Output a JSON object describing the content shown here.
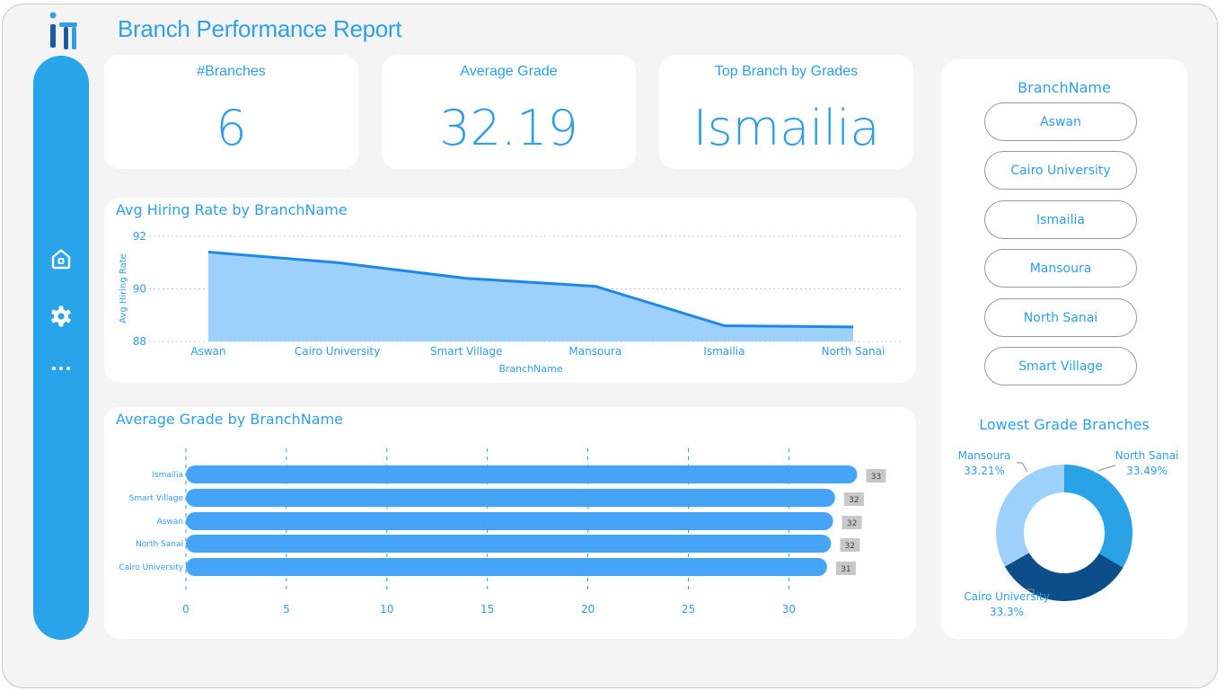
{
  "report": {
    "title": "Branch Performance Report"
  },
  "colors": {
    "accent": "#2fa0e8",
    "sidebar": "#29a3ea",
    "bar": "#45a4f5",
    "area_fill": "#9ed0fc",
    "area_line": "#1e88e5",
    "donut": [
      "#2aa3e6",
      "#0d4e8a",
      "#9ed0fc"
    ]
  },
  "sidebar": {
    "icons": [
      "home-icon",
      "gear-icon",
      "more-icon"
    ]
  },
  "kpis": [
    {
      "label": "#Branches",
      "value": "6"
    },
    {
      "label": "Average Grade",
      "value": "32.19"
    },
    {
      "label": "Top Branch by Grades",
      "value": "Ismailia"
    }
  ],
  "slicer": {
    "title": "BranchName",
    "items": [
      "Aswan",
      "Cairo University",
      "Ismailia",
      "Mansoura",
      "North Sanai",
      "Smart Village"
    ]
  },
  "chart_data": [
    {
      "type": "area",
      "title": "Avg Hiring Rate by BranchName",
      "xlabel": "BranchName",
      "ylabel": "Avg Hiring Rate",
      "categories": [
        "Aswan",
        "Cairo University",
        "Smart Village",
        "Mansoura",
        "Ismailia",
        "North Sanai"
      ],
      "values": [
        91.4,
        91.0,
        90.4,
        90.1,
        88.6,
        88.55
      ],
      "ylim": [
        88,
        92
      ],
      "yticks": [
        "88",
        "90",
        "92"
      ],
      "grid": true
    },
    {
      "type": "bar",
      "orientation": "horizontal",
      "title": "Average Grade by BranchName",
      "categories": [
        "Ismailia",
        "Smart Village",
        "Aswan",
        "North Sanai",
        "Cairo University"
      ],
      "values": [
        33.4,
        32.3,
        32.2,
        32.1,
        31.9
      ],
      "data_labels": [
        "33",
        "32",
        "32",
        "32",
        "31"
      ],
      "xlim": [
        0,
        35
      ],
      "xticks": [
        "0",
        "5",
        "10",
        "15",
        "20",
        "25",
        "30"
      ],
      "grid": true
    },
    {
      "type": "pie",
      "variant": "donut",
      "title": "Lowest Grade Branches",
      "labels": [
        "North Sanai",
        "Cairo University",
        "Mansoura"
      ],
      "values": [
        33.49,
        33.3,
        33.21
      ],
      "value_labels": [
        "33.49%",
        "33.3%",
        "33.21%"
      ]
    }
  ]
}
